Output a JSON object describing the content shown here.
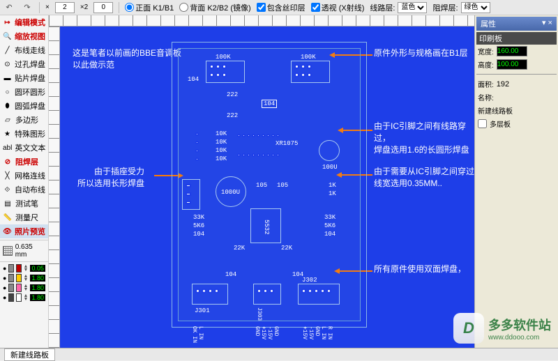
{
  "toolbar": {
    "front_label": "正面 K1/B1",
    "back_label": "背面 K2/B2 (镜像)",
    "silk_label": "包含丝印层",
    "xray_label": "透视 (X射线)",
    "trace_label": "线路层:",
    "trace_option": "蓝色",
    "resist_label": "阻焊层:",
    "resist_option": "绿色",
    "x_val": "2",
    "x2_val": "0"
  },
  "tools": [
    {
      "icon": "↦",
      "label": "编辑模式",
      "red": true
    },
    {
      "icon": "🔍",
      "label": "缩放视图",
      "red": true
    },
    {
      "icon": "╱",
      "label": "布线走线"
    },
    {
      "icon": "⊙",
      "label": "过孔焊盘"
    },
    {
      "icon": "▬",
      "label": "贴片焊盘"
    },
    {
      "icon": "○",
      "label": "圆环圆形"
    },
    {
      "icon": "⬮",
      "label": "圆弧焊盘"
    },
    {
      "icon": "▱",
      "label": "多边形"
    },
    {
      "icon": "★",
      "label": "特殊图形"
    },
    {
      "icon": "abl",
      "label": "英文文本"
    },
    {
      "icon": "⊘",
      "label": "阻焊层",
      "red": true
    },
    {
      "icon": "╳",
      "label": "网格连线"
    },
    {
      "icon": "⟐",
      "label": "自动布线"
    },
    {
      "icon": "▤",
      "label": "测试笔"
    },
    {
      "icon": "📏",
      "label": "测量尺"
    },
    {
      "icon": "👁",
      "label": "照片预览",
      "red": true,
      "active": true
    }
  ],
  "grid": {
    "value": "0.635 mm"
  },
  "layers": [
    {
      "pair": [
        "#888",
        "#c00000"
      ],
      "size": "0.05"
    },
    {
      "pair": [
        "#888",
        "#ffcc00"
      ],
      "size": "1.80"
    },
    {
      "pair": [
        "#888",
        "#ff66aa"
      ],
      "size": "1.80"
    },
    {
      "pair": [
        "#444",
        "#ffffff"
      ],
      "size": "1.80"
    }
  ],
  "pcb": {
    "labels": {
      "c104_1": "104",
      "r100k_1": "100K",
      "r100k_2": "100K",
      "t222_1": "222",
      "c104_2": "104",
      "t222_2": "222",
      "r10k_1": "10K",
      "r10k_2": "10K",
      "r10k_3": "10K",
      "r10k_4": "10K",
      "ic": "XR1075",
      "c100u": "100U",
      "c1000u": "1000U",
      "c105_1": "105",
      "c105_2": "105",
      "r1k_1": "1K",
      "r1k_2": "1K",
      "r33k": "33K",
      "r33k_2": "33K",
      "r5k6": "5K6",
      "r5k6_2": "5K6",
      "c104_3": "104",
      "c104_4": "104",
      "r22k_1": "22K",
      "r22k_2": "22K",
      "ic2": "5532",
      "c104_5": "104",
      "c104_6": "104",
      "j301": "J301",
      "j302": "J302",
      "j303": "J303",
      "bottom_left": "L IN\nOK IN",
      "bottom_mid": "GND\n-15V\n+15V\nGND",
      "bottom_right": "R IN\nL IN\nGND\n-15V\n+15V"
    }
  },
  "annotations": {
    "a1": "这是笔者以前画的BBE音调板\n以此做示范",
    "a2": "原件外形与规格画在B1层",
    "a3": "由于IC引脚之间有线路穿过，\n焊盘选用1.6的长圆形焊盘",
    "a4": "由于需要从IC引脚之间穿过\n线宽选用0.35MM..",
    "a5": "由于插座受力\n所以选用长形焊盘",
    "a6": "所有原件使用双面焊盘，"
  },
  "right_panel": {
    "title": "属性",
    "section": "印刷板",
    "width_label": "宽度:",
    "width_val": "160.00",
    "height_label": "高度:",
    "height_val": "100.00",
    "area_label": "面积:",
    "area_val": "192",
    "name_label": "名称:",
    "name_val": "新建线路板",
    "multi_label": "多层板"
  },
  "status": {
    "tab": "新建线路板"
  },
  "watermark": {
    "cn": "多多软件站",
    "url": "www.ddooo.com",
    "logo": "D"
  }
}
